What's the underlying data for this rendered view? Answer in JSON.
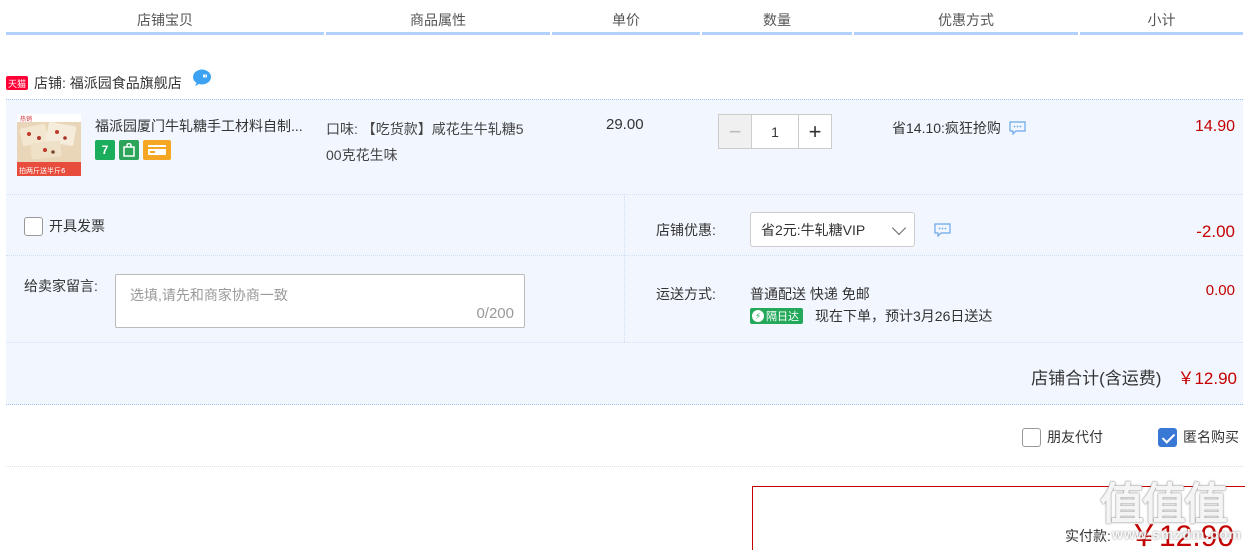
{
  "header": {
    "cols": [
      "店铺宝贝",
      "商品属性",
      "单价",
      "数量",
      "优惠方式",
      "小计"
    ]
  },
  "shop": {
    "badge": "天猫",
    "label": "店铺: 福派园食品旗舰店"
  },
  "item": {
    "title": "福派园厦门牛轧糖手工材料自制...",
    "icon_7": "7",
    "attr_line1": "口味: 【吃货款】咸花生牛轧糖5",
    "attr_line2": "00克花生味",
    "price": "29.00",
    "quantity": "1",
    "minus": "−",
    "plus": "+",
    "discount": "省14.10:疯狂抢购",
    "subtotal": "14.90",
    "thumb_text_top": "热销",
    "thumb_text_bottom": "拍两斤送半斤6"
  },
  "invoice": {
    "label": "开具发票",
    "checked": false
  },
  "memo": {
    "label": "给卖家留言:",
    "placeholder": "选填,请先和商家协商一致",
    "counter": "0/200"
  },
  "coupon": {
    "label": "店铺优惠:",
    "selected": "省2元:牛轧糖VIP",
    "amount": "-2.00"
  },
  "shipping": {
    "label": "运送方式:",
    "method": "普通配送 快递 免邮",
    "badge": "隔日达",
    "eta": "现在下单，预计3月26日送达",
    "amount": "0.00"
  },
  "total": {
    "label": "店铺合计(含运费)",
    "amount": "￥12.90"
  },
  "options": {
    "friend_pay": "朋友代付",
    "anonymous": "匿名购买"
  },
  "pay": {
    "label": "实付款:",
    "amount": "￥12.90"
  },
  "watermark": {
    "logo": "值值值",
    "site": "www.smzdm.com"
  },
  "colors": {
    "accent_red": "#c40000",
    "panel_bg": "#f2f7ff",
    "header_bar": "#b2d1ff",
    "tmall_red": "#ff0036",
    "checkbox_blue": "#3a78d6"
  }
}
